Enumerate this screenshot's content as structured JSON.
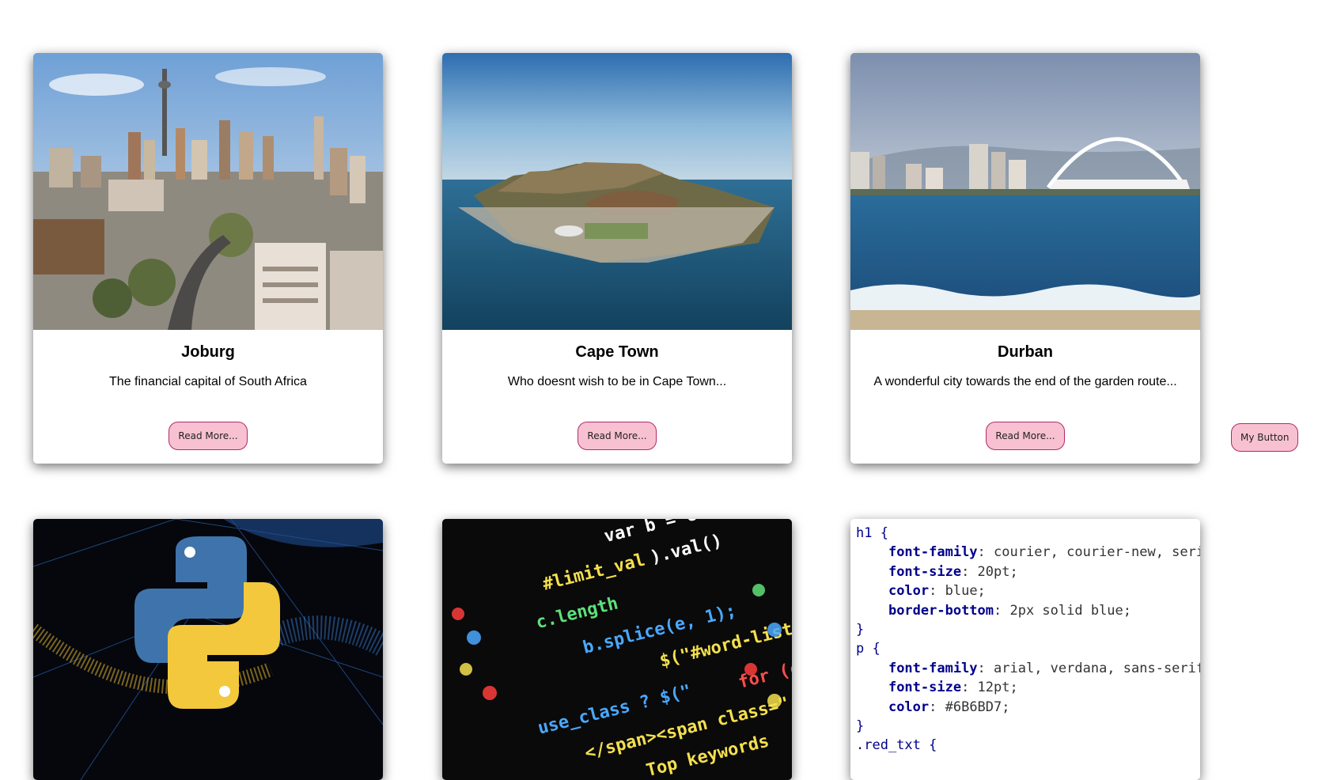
{
  "cards": [
    {
      "title": "Joburg",
      "description": "The financial capital of South Africa",
      "button": "Read More..."
    },
    {
      "title": "Cape Town",
      "description": "Who doesnt wish to be in Cape Town...",
      "button": "Read More..."
    },
    {
      "title": "Durban",
      "description": "A wonderful city towards the end of the garden route...",
      "button": "Read More..."
    }
  ],
  "my_button": "My Button",
  "code_snippet": {
    "lines": [
      {
        "sel": "h1 {"
      },
      {
        "prop": "font-family",
        "val": ": courier, courier-new, serif;"
      },
      {
        "prop": "font-size",
        "val": ": 20pt;"
      },
      {
        "prop": "color",
        "val": ": blue;"
      },
      {
        "prop": "border-bottom",
        "val": ": 2px solid blue;"
      },
      {
        "sel": "}"
      },
      {
        "sel": "p {"
      },
      {
        "prop": "font-family",
        "val": ": arial, verdana, sans-serif;"
      },
      {
        "prop": "font-size",
        "val": ": 12pt;"
      },
      {
        "prop": "color",
        "val": ": #6B6BD7;"
      },
      {
        "sel": "}"
      },
      {
        "sel": ".red_txt {"
      }
    ]
  },
  "code_image_tokens": [
    "var b = count",
    "#limit_val",
    ").val()",
    "c.length",
    "b.splice(e, 1);",
    "$(\"#word-list-out\")",
    "use_class ? $(\"",
    "</span><span class=\"",
    "Top keywords",
    "for (c"
  ]
}
